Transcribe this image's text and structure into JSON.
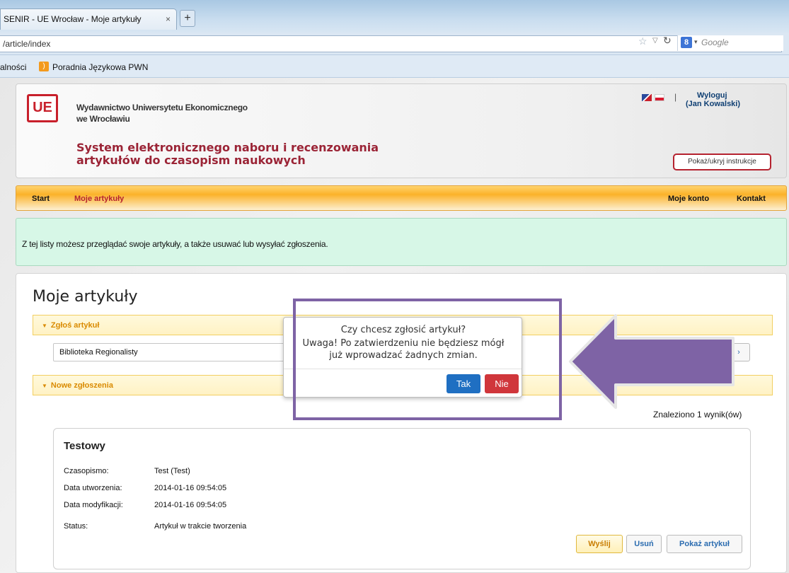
{
  "browser": {
    "tab_title": "SENIR - UE Wrocław - Moje artykuły",
    "tab_close": "×",
    "new_tab": "+",
    "url": "/article/index",
    "search_placeholder": "Google",
    "bookmark_partial": "alności",
    "bookmark_link": "Poradnia Językowa PWN"
  },
  "header": {
    "logo_text": "UE",
    "publisher_line1": "Wydawnictwo Uniwersytetu Ekonomicznego",
    "publisher_line2": "we Wrocławiu",
    "system_line1": "System elektronicznego naboru i recenzowania",
    "system_line2": "artykułów do czasopism naukowych",
    "separator": "|",
    "logout_label": "Wyloguj",
    "user_label": "(Jan Kowalski)",
    "instructions_button": "Pokaż/ukryj instrukcje"
  },
  "nav": {
    "start": "Start",
    "my_articles": "Moje artykuły",
    "my_account": "Moje konto",
    "contact": "Kontakt"
  },
  "info": {
    "text": "Z tej listy możesz przeglądać swoje artykuły, a także usuwać lub wysyłać zgłoszenia."
  },
  "main": {
    "title": "Moje artykuły",
    "section_submit": "Zgłoś artykuł",
    "journal_selected": "Biblioteka Regionalisty",
    "section_new": "Nowe zgłoszenia",
    "results_count": "Znaleziono 1 wynik(ów)",
    "article": {
      "title": "Testowy",
      "journal_label": "Czasopismo:",
      "journal_value": "Test (Test)",
      "created_label": "Data utworzenia:",
      "created_value": "2014-01-16 09:54:05",
      "modified_label": "Data modyfikacji:",
      "modified_value": "2014-01-16 09:54:05",
      "status_label": "Status:",
      "status_value": "Artykuł w trakcie tworzenia",
      "send_button": "Wyślij",
      "delete_button": "Usuń",
      "show_button": "Pokaż artykuł"
    }
  },
  "dialog": {
    "question": "Czy chcesz zgłosić artykuł?",
    "warning_line1": "Uwaga! Po zatwierdzeniu nie będziesz mógł",
    "warning_line2": "już wprowadzać żadnych zmian.",
    "yes_button": "Tak",
    "no_button": "Nie"
  },
  "colors": {
    "brand_red": "#9b2436",
    "nav_orange": "#fbb22a",
    "info_green": "#d7f7e7",
    "annotation_purple": "#7e63a5",
    "yes_blue": "#1f6fc2",
    "no_red": "#d0363b"
  },
  "icons": [
    "tab-close-icon",
    "new-tab-icon",
    "star-icon",
    "reload-icon",
    "google-icon",
    "rss-icon",
    "flag-uk-icon",
    "flag-pl-icon",
    "triangle-down-icon",
    "arrow-left-annotation"
  ]
}
